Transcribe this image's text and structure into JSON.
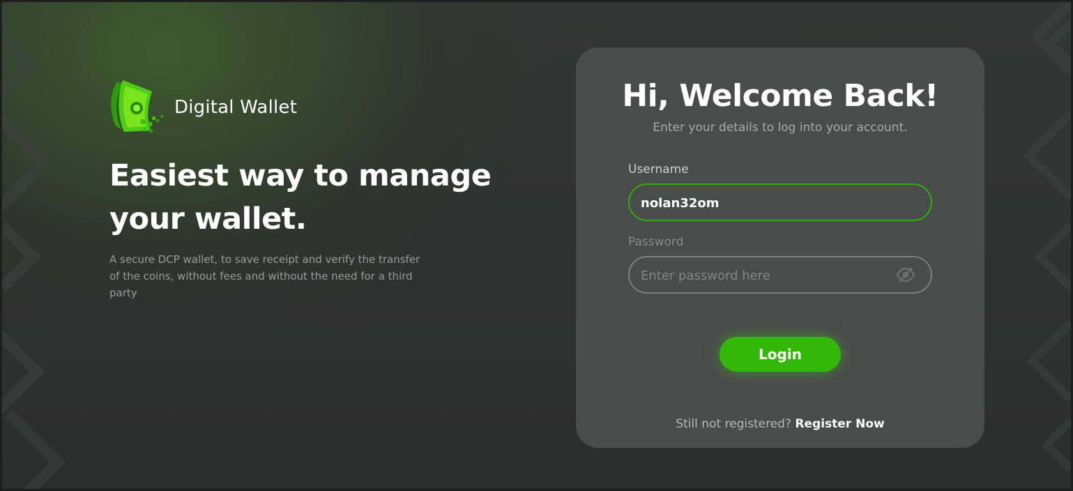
{
  "brand": {
    "name": "Digital Wallet",
    "logo_icon": "money-wallet-logo-icon",
    "accent_color": "#33b80a"
  },
  "hero": {
    "headline_line1": "Easiest way to manage",
    "headline_line2": "your wallet.",
    "description": "A secure DCP wallet, to save receipt and verify the transfer of the coins, without fees and without the need for a third party"
  },
  "login_card": {
    "title": "Hi, Welcome Back!",
    "subtitle": "Enter your details to log into your account.",
    "username_label": "Username",
    "username_value": "nolan32om",
    "password_label": "Password",
    "password_placeholder": "Enter password here",
    "password_toggle_icon": "eye-slash-icon",
    "login_button": "Login",
    "register_prompt": "Still not registered?",
    "register_link": "Register Now"
  }
}
